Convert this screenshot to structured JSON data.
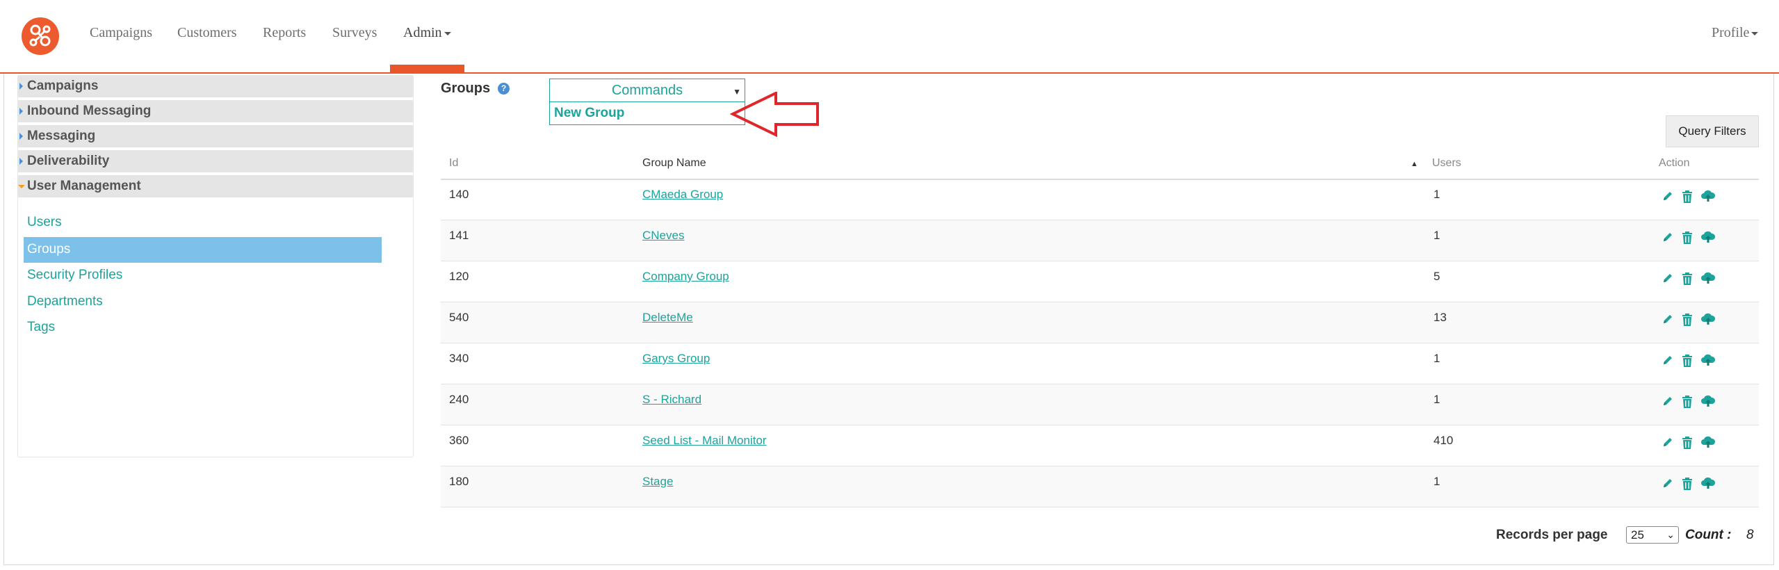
{
  "nav": {
    "items": [
      "Campaigns",
      "Customers",
      "Reports",
      "Surveys",
      "Admin"
    ],
    "active": "Admin",
    "profile": "Profile"
  },
  "sidebar": {
    "sections": [
      "Campaigns",
      "Inbound Messaging",
      "Messaging",
      "Deliverability",
      "User Management"
    ],
    "expanded": "User Management",
    "links": [
      "Users",
      "Groups",
      "Security Profiles",
      "Departments",
      "Tags"
    ],
    "selected": "Groups"
  },
  "page": {
    "title": "Groups",
    "help_icon": "?"
  },
  "commands": {
    "label": "Commands",
    "menu_item": "New Group"
  },
  "query_filters": "Query Filters",
  "table": {
    "columns": [
      "Id",
      "Group Name",
      "Users",
      "Action"
    ],
    "sort": "ascending",
    "rows": [
      {
        "id": "140",
        "name": "CMaeda Group",
        "users": "1"
      },
      {
        "id": "141",
        "name": "CNeves",
        "users": "1"
      },
      {
        "id": "120",
        "name": "Company Group",
        "users": "5"
      },
      {
        "id": "540",
        "name": "DeleteMe",
        "users": "13"
      },
      {
        "id": "340",
        "name": "Garys Group",
        "users": "1"
      },
      {
        "id": "240",
        "name": "S - Richard",
        "users": "1"
      },
      {
        "id": "360",
        "name": "Seed List - Mail Monitor",
        "users": "410"
      },
      {
        "id": "180",
        "name": "Stage",
        "users": "1"
      }
    ],
    "action_icons": [
      "edit-icon",
      "trash-icon",
      "cloud-upload-icon"
    ]
  },
  "footer": {
    "records_label": "Records per page",
    "per_page": "25",
    "count_label": "Count  :",
    "count_value": "8"
  },
  "colors": {
    "brand": "#ec5a2e",
    "teal": "#1ba39c",
    "selected": "#7dc0ea",
    "annotation": "#e0262a"
  }
}
